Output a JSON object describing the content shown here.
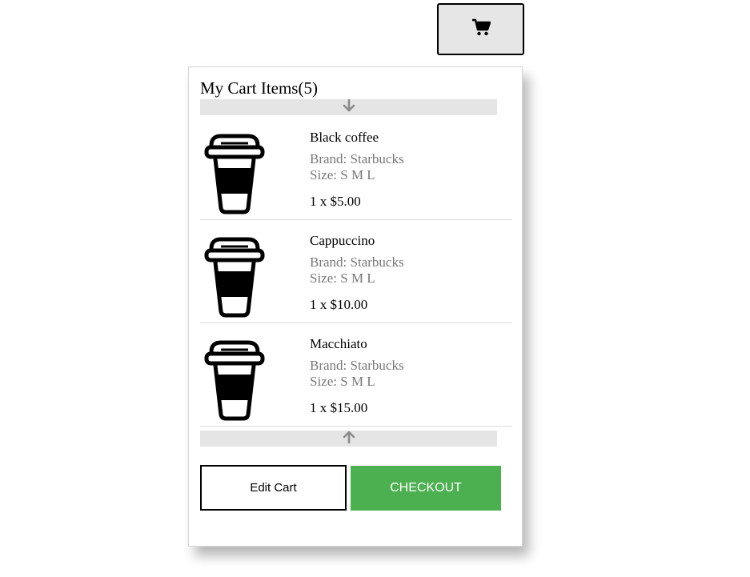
{
  "header": {
    "cart_toggle_icon": "shopping-cart-icon"
  },
  "cart": {
    "title": "My Cart Items(5)",
    "scroll_down_icon": "arrow-down-icon",
    "scroll_up_icon": "arrow-up-icon",
    "items": [
      {
        "name": "Black coffee",
        "brand": "Brand: Starbucks",
        "size": "Size: S M L",
        "qty_price": "1 x $5.00",
        "icon": "coffee-cup-icon"
      },
      {
        "name": "Cappuccino",
        "brand": "Brand: Starbucks",
        "size": "Size: S M L",
        "qty_price": "1 x $10.00",
        "icon": "coffee-cup-icon"
      },
      {
        "name": "Macchiato",
        "brand": "Brand: Starbucks",
        "size": "Size: S M L",
        "qty_price": "1 x $15.00",
        "icon": "coffee-cup-icon"
      }
    ],
    "edit_label": "Edit Cart",
    "checkout_label": "CHECKOUT"
  },
  "colors": {
    "checkout_bg": "#4caf50",
    "toggle_bg": "#e6e6e6",
    "scroll_bg": "#e5e5e5",
    "muted_text": "#777777"
  }
}
